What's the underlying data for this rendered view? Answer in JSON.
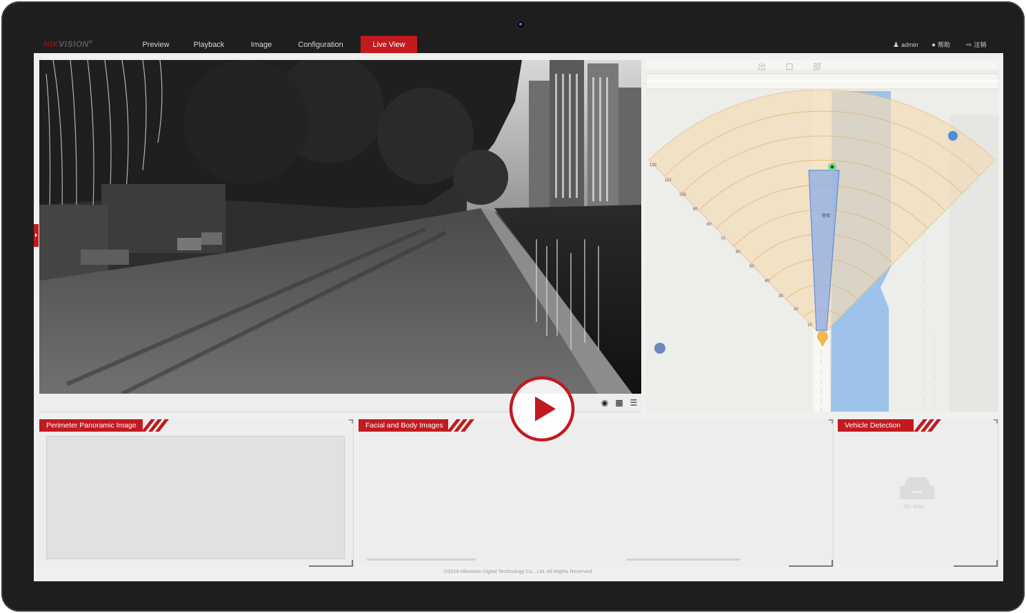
{
  "nav": {
    "logo_brand": "HIK",
    "logo_rest": "VISION",
    "logo_mark": "®",
    "tabs": [
      {
        "label": "Preview"
      },
      {
        "label": "Playback"
      },
      {
        "label": "Image"
      },
      {
        "label": "Configuration"
      },
      {
        "label": "Live View",
        "active": true
      }
    ],
    "user": "admin",
    "help": "帮助",
    "logout": "注销"
  },
  "map": {
    "distance_labels": [
      "120",
      "110",
      "100",
      "90",
      "80",
      "70",
      "60",
      "50",
      "40",
      "30",
      "20",
      "10"
    ],
    "target_label": "警情",
    "road_labels": [
      "出",
      "口",
      "部"
    ]
  },
  "panels": {
    "perimeter": {
      "title": "Perimeter Panoramic Image"
    },
    "facial": {
      "title": "Facial and Body Images"
    },
    "vehicle": {
      "title": "Vehicle Detection",
      "empty_text": "No data"
    }
  },
  "footer": "©2019 Hikvision Digital Technology Co., Ltd. All Rights Reserved.",
  "colors": {
    "accent": "#c11a1f",
    "nav_bg": "#1e1e1e",
    "radar_fill": "#f3dcb6",
    "water": "#9ec3ea",
    "detection_zone": "#8eaee8"
  }
}
